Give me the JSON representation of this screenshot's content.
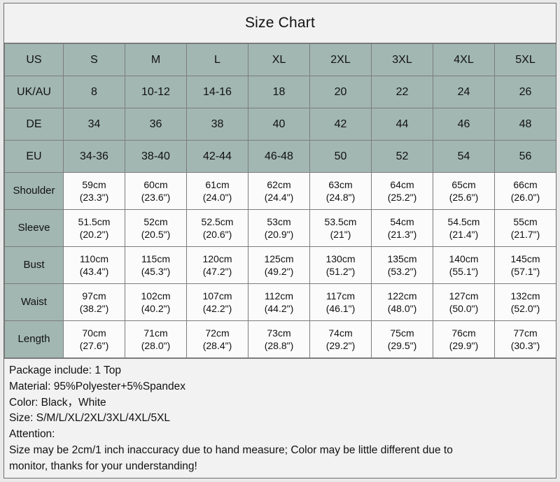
{
  "title": "Size Chart",
  "table": {
    "size_rows": [
      {
        "label": "US",
        "values": [
          "S",
          "M",
          "L",
          "XL",
          "2XL",
          "3XL",
          "4XL",
          "5XL"
        ]
      },
      {
        "label": "UK/AU",
        "values": [
          "8",
          "10-12",
          "14-16",
          "18",
          "20",
          "22",
          "24",
          "26"
        ]
      },
      {
        "label": "DE",
        "values": [
          "34",
          "36",
          "38",
          "40",
          "42",
          "44",
          "46",
          "48"
        ]
      },
      {
        "label": "EU",
        "values": [
          "34-36",
          "38-40",
          "42-44",
          "46-48",
          "50",
          "52",
          "54",
          "56"
        ]
      }
    ],
    "measurement_rows": [
      {
        "label": "Shoulder",
        "cm": [
          "59cm",
          "60cm",
          "61cm",
          "62cm",
          "63cm",
          "64cm",
          "65cm",
          "66cm"
        ],
        "inch": [
          "(23.3\")",
          "(23.6\")",
          "(24.0\")",
          "(24.4\")",
          "(24.8\")",
          "(25.2\")",
          "(25.6\")",
          "(26.0\")"
        ]
      },
      {
        "label": "Sleeve",
        "cm": [
          "51.5cm",
          "52cm",
          "52.5cm",
          "53cm",
          "53.5cm",
          "54cm",
          "54.5cm",
          "55cm"
        ],
        "inch": [
          "(20.2\")",
          "(20.5\")",
          "(20.6\")",
          "(20.9\")",
          "(21\")",
          "(21.3\")",
          "(21.4\")",
          "(21.7\")"
        ]
      },
      {
        "label": "Bust",
        "cm": [
          "110cm",
          "115cm",
          "120cm",
          "125cm",
          "130cm",
          "135cm",
          "140cm",
          "145cm"
        ],
        "inch": [
          "(43.4\")",
          "(45.3\")",
          "(47.2\")",
          "(49.2\")",
          "(51.2\")",
          "(53.2\")",
          "(55.1\")",
          "(57.1\")"
        ]
      },
      {
        "label": "Waist",
        "cm": [
          "97cm",
          "102cm",
          "107cm",
          "112cm",
          "117cm",
          "122cm",
          "127cm",
          "132cm"
        ],
        "inch": [
          "(38.2\")",
          "(40.2\")",
          "(42.2\")",
          "(44.2\")",
          "(46.1\")",
          "(48.0\")",
          "(50.0\")",
          "(52.0\")"
        ]
      },
      {
        "label": "Length",
        "cm": [
          "70cm",
          "71cm",
          "72cm",
          "73cm",
          "74cm",
          "75cm",
          "76cm",
          "77cm"
        ],
        "inch": [
          "(27.6\")",
          "(28.0\")",
          "(28.4\")",
          "(28.8\")",
          "(29.2\")",
          "(29.5\")",
          "(29.9\")",
          "(30.3\")"
        ]
      }
    ]
  },
  "notes": [
    "Package include: 1 Top",
    "Material: 95%Polyester+5%Spandex",
    "Color: Black，White",
    "Size: S/M/L/XL/2XL/3XL/4XL/5XL",
    "Attention:",
    "Size may be 2cm/1 inch inaccuracy due to hand measure; Color may be little different due to",
    "monitor, thanks for your understanding!"
  ],
  "colors": {
    "header_teal": "#a2b7b2",
    "cell_white": "#fbfbfb",
    "page_background": "#f2f2f2",
    "border": "#7c7c7c",
    "text": "#111111"
  }
}
